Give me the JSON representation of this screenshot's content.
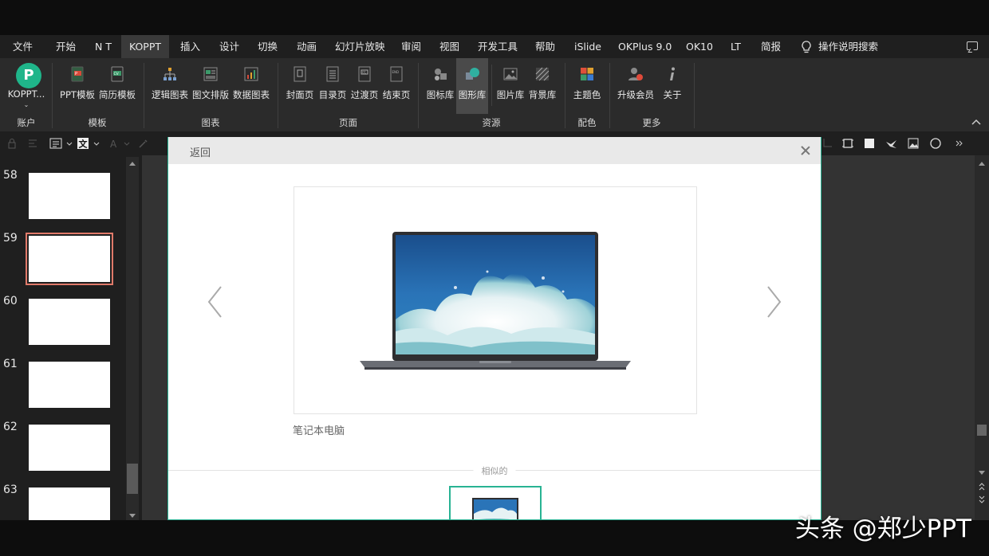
{
  "menu": {
    "items": [
      "文件",
      "开始",
      "N T",
      "KOPPT",
      "插入",
      "设计",
      "切换",
      "动画",
      "幻灯片放映",
      "审阅",
      "视图",
      "开发工具",
      "帮助",
      "iSlide",
      "OKPlus 9.0",
      "OK10",
      "LT",
      "简报"
    ],
    "active": "KOPPT",
    "search_label": "操作说明搜索"
  },
  "ribbon": {
    "account_button": "KOPPT...",
    "groups": [
      {
        "label": "账户"
      },
      {
        "label": "模板",
        "buttons": [
          "PPT模板",
          "简历模板"
        ]
      },
      {
        "label": "图表",
        "buttons": [
          "逻辑图表",
          "图文排版",
          "数据图表"
        ]
      },
      {
        "label": "页面",
        "buttons": [
          "封面页",
          "目录页",
          "过渡页",
          "结束页"
        ]
      },
      {
        "label": "资源",
        "buttons": [
          "图标库",
          "图形库",
          "图片库",
          "背景库"
        ]
      },
      {
        "label": "配色",
        "buttons": [
          "主题色"
        ]
      },
      {
        "label": "更多",
        "buttons": [
          "升级会员",
          "关于"
        ]
      }
    ],
    "active_button": "图形库"
  },
  "slides": {
    "numbers": [
      "58",
      "59",
      "60",
      "61",
      "62",
      "63"
    ],
    "selected": "59"
  },
  "dialog": {
    "back_label": "返回",
    "caption": "笔记本电脑",
    "similar_label": "相似的"
  },
  "watermark": "头条 @郑少PPT",
  "colors": {
    "accent": "#28b393",
    "selected_slide": "#e07a6a",
    "logo": "#1fb58a"
  }
}
